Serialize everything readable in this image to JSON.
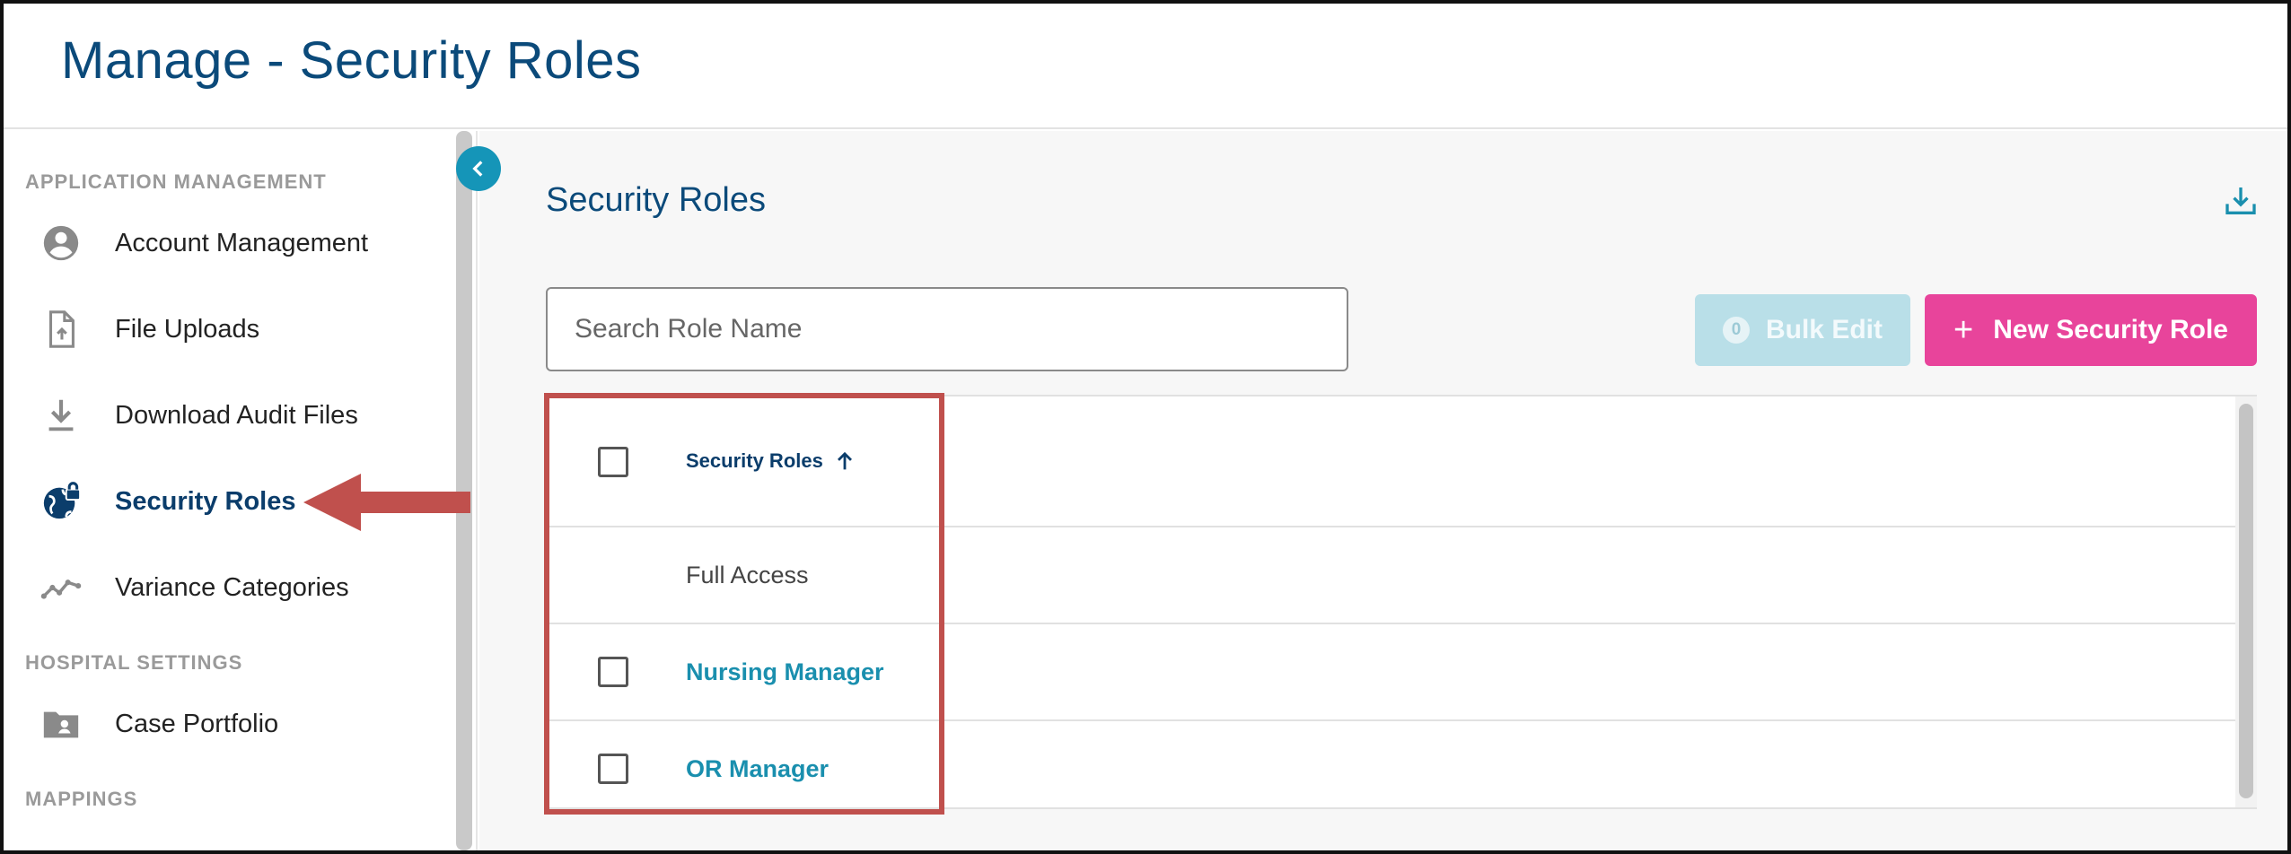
{
  "header": {
    "title": "Manage - Security Roles"
  },
  "sidebar": {
    "sections": [
      {
        "heading": "APPLICATION MANAGEMENT"
      },
      {
        "heading": "HOSPITAL SETTINGS"
      },
      {
        "heading": "MAPPINGS"
      }
    ],
    "items": [
      {
        "label": "Account Management",
        "icon": "account-circle-icon"
      },
      {
        "label": "File Uploads",
        "icon": "file-upload-icon"
      },
      {
        "label": "Download Audit Files",
        "icon": "download-icon"
      },
      {
        "label": "Security Roles",
        "icon": "globe-lock-icon",
        "active": true
      },
      {
        "label": "Variance Categories",
        "icon": "trend-line-icon"
      },
      {
        "label": "Case Portfolio",
        "icon": "folder-account-icon"
      }
    ]
  },
  "main": {
    "title": "Security Roles",
    "search": {
      "placeholder": "Search Role Name",
      "value": ""
    },
    "bulk_edit": {
      "count": "0",
      "label": "Bulk Edit"
    },
    "new_role": {
      "plus": "+",
      "label": "New Security Role"
    },
    "table": {
      "column_header": "Security Roles",
      "sort": "ascending",
      "rows": [
        {
          "name": "Full Access",
          "selectable": false
        },
        {
          "name": "Nursing Manager",
          "selectable": true
        },
        {
          "name": "OR Manager",
          "selectable": true
        }
      ]
    }
  },
  "colors": {
    "title_blue": "#0b4a7a",
    "link_teal": "#1a8fae",
    "accent_pink": "#e8449b",
    "bulk_disabled": "#b9dfe8",
    "annotation_red": "#c0504d"
  }
}
